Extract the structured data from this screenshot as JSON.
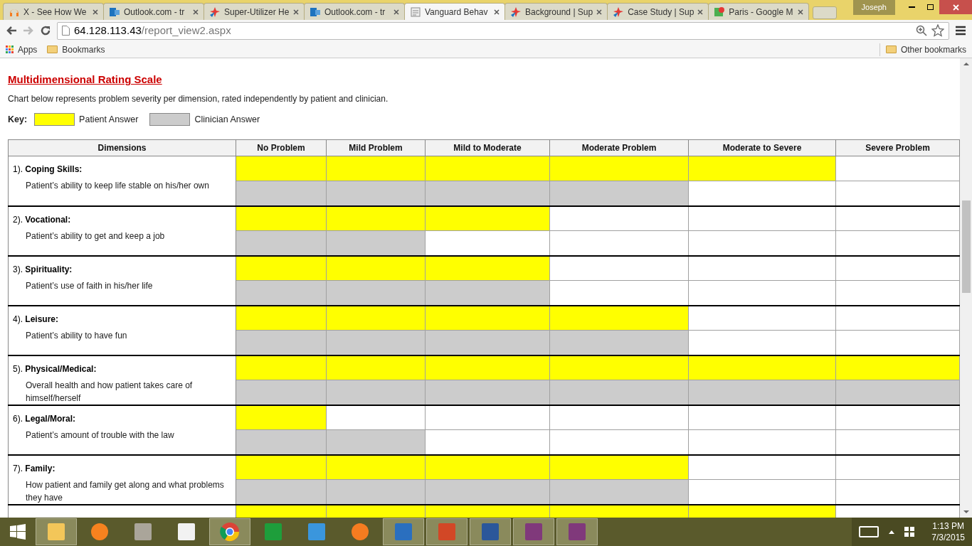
{
  "browser": {
    "tabs": [
      {
        "title": "X - See How We",
        "selected": false
      },
      {
        "title": "Outlook.com - tr",
        "selected": false
      },
      {
        "title": "Super-Utilizer He",
        "selected": false
      },
      {
        "title": "Outlook.com - tr",
        "selected": false
      },
      {
        "title": "Vanguard Behav",
        "selected": true
      },
      {
        "title": "Background | Sup",
        "selected": false
      },
      {
        "title": "Case Study | Sup",
        "selected": false
      },
      {
        "title": "Paris - Google M",
        "selected": false
      }
    ],
    "user": "Joseph",
    "address": {
      "host": "64.128.113.43",
      "path": "/report_view2.aspx"
    },
    "bookmarks": [
      "Apps",
      "Bookmarks"
    ],
    "other_bookmarks": "Other bookmarks"
  },
  "page": {
    "title": "Multidimensional Rating Scale",
    "intro": "Chart below represents problem severity per dimension, rated independently by patient and clinician.",
    "key": {
      "label": "Key:",
      "patient": "Patient Answer",
      "clinician": "Clinician Answer"
    },
    "columns": [
      "Dimensions",
      "No Problem",
      "Mild Problem",
      "Mild to Moderate",
      "Moderate Problem",
      "Moderate to Severe",
      "Severe Problem"
    ],
    "rows": [
      {
        "number": "1).",
        "name": "Coping Skills:",
        "description": "Patient’s ability to keep life stable on his/her own",
        "patient": [
          true,
          true,
          true,
          true,
          true,
          false
        ],
        "clinician": [
          true,
          true,
          true,
          true,
          false,
          false
        ]
      },
      {
        "number": "2).",
        "name": "Vocational:",
        "description": "Patient’s ability to get and keep a job",
        "patient": [
          true,
          true,
          true,
          false,
          false,
          false
        ],
        "clinician": [
          true,
          true,
          false,
          false,
          false,
          false
        ]
      },
      {
        "number": "3).",
        "name": "Spirituality:",
        "description": "Patient’s use of faith in his/her life",
        "patient": [
          true,
          true,
          true,
          false,
          false,
          false
        ],
        "clinician": [
          true,
          true,
          true,
          false,
          false,
          false
        ]
      },
      {
        "number": "4).",
        "name": "Leisure:",
        "description": "Patient’s ability to have fun",
        "patient": [
          true,
          true,
          true,
          true,
          false,
          false
        ],
        "clinician": [
          true,
          true,
          true,
          true,
          false,
          false
        ]
      },
      {
        "number": "5).",
        "name": "Physical/Medical:",
        "description": "Overall health and how patient takes care of himself/herself",
        "patient": [
          true,
          true,
          true,
          true,
          true,
          true
        ],
        "clinician": [
          true,
          true,
          true,
          true,
          true,
          true
        ]
      },
      {
        "number": "6).",
        "name": "Legal/Moral:",
        "description": "Patient’s amount of trouble with the law",
        "patient": [
          true,
          false,
          false,
          false,
          false,
          false
        ],
        "clinician": [
          true,
          true,
          false,
          false,
          false,
          false
        ]
      },
      {
        "number": "7).",
        "name": "Family:",
        "description": "How patient and family get along and what problems they have",
        "patient": [
          true,
          true,
          true,
          true,
          false,
          false
        ],
        "clinician": [
          true,
          true,
          true,
          true,
          false,
          false
        ]
      },
      {
        "patient": [
          true,
          true,
          true,
          true,
          true,
          false
        ]
      }
    ]
  },
  "taskbar": {
    "apps": [
      {
        "running": true
      },
      {
        "running": false
      },
      {
        "running": false
      },
      {
        "running": false
      },
      {
        "running": true
      },
      {
        "running": false
      },
      {
        "running": false
      },
      {
        "running": false
      },
      {
        "running": true
      },
      {
        "running": true
      },
      {
        "running": true
      },
      {
        "running": true
      },
      {
        "running": true
      }
    ],
    "time": "1:13 PM",
    "date": "7/3/2015"
  }
}
